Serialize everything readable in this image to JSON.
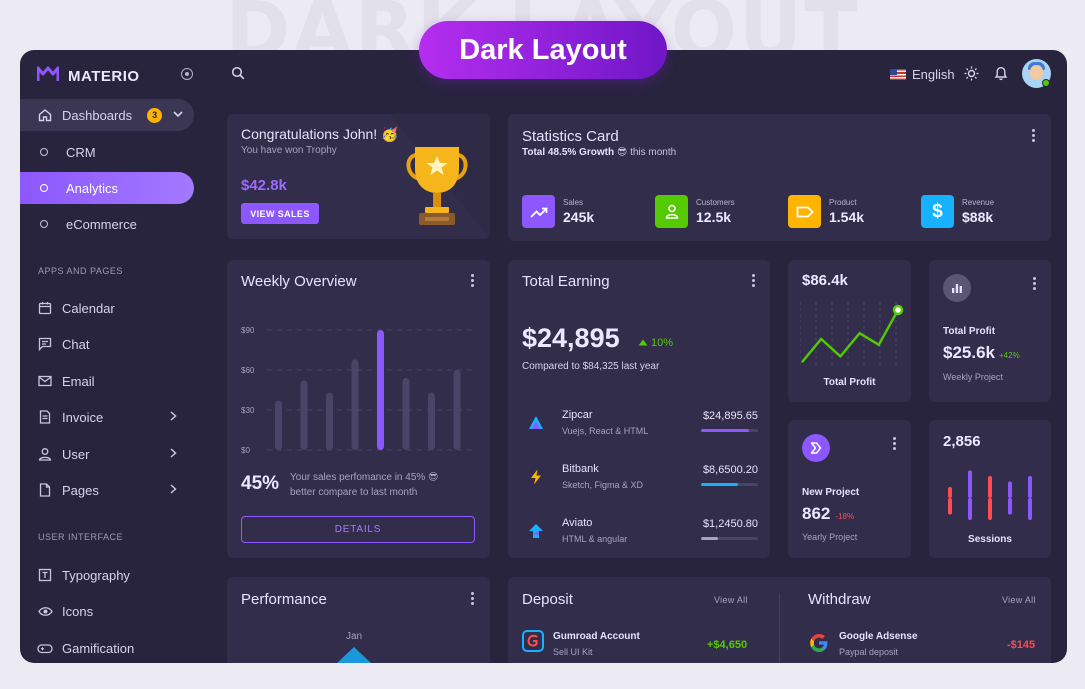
{
  "background_title": "DARK LAYOUT",
  "banner": {
    "label": "Dark Layout"
  },
  "brand": {
    "name": "MATERIO"
  },
  "sidebar": {
    "dashboards": {
      "label": "Dashboards",
      "badge": "3"
    },
    "sub_items": [
      {
        "label": "CRM"
      },
      {
        "label": "Analytics"
      },
      {
        "label": "eCommerce"
      }
    ],
    "section_apps": "APPS AND PAGES",
    "apps": [
      {
        "label": "Calendar"
      },
      {
        "label": "Chat"
      },
      {
        "label": "Email"
      },
      {
        "label": "Invoice"
      },
      {
        "label": "User"
      },
      {
        "label": "Pages"
      }
    ],
    "section_ui": "USER INTERFACE",
    "ui": [
      {
        "label": "Typography"
      },
      {
        "label": "Icons"
      },
      {
        "label": "Gamification"
      }
    ]
  },
  "topbar": {
    "language": "English"
  },
  "congrats": {
    "title": "Congratulations John! 🥳",
    "subtitle": "You have won Trophy",
    "amount": "$42.8k",
    "button": "VIEW SALES"
  },
  "statistics": {
    "title": "Statistics Card",
    "growth": "Total 48.5% Growth",
    "growth_emoji": "😎",
    "period": "this month",
    "items": [
      {
        "label": "Sales",
        "value": "245k",
        "color": "#8c57ff",
        "icon": "trending-up-icon"
      },
      {
        "label": "Customers",
        "value": "12.5k",
        "color": "#56ca00",
        "icon": "user-icon"
      },
      {
        "label": "Product",
        "value": "1.54k",
        "color": "#ffb400",
        "icon": "label-icon"
      },
      {
        "label": "Revenue",
        "value": "$88k",
        "color": "#16b1ff",
        "icon": "dollar-icon"
      }
    ]
  },
  "weekly": {
    "title": "Weekly Overview",
    "y_ticks": [
      "$90",
      "$60",
      "$30",
      "$0"
    ],
    "percent": "45%",
    "text_line1": "Your sales perfomance in 45% 😎",
    "text_line2": "better compare to last month",
    "button": "DETAILS"
  },
  "earning": {
    "title": "Total Earning",
    "amount": "$24,895",
    "change": "10%",
    "compare": "Compared to $84,325 last year",
    "rows": [
      {
        "name": "Zipcar",
        "sub": "Vuejs, React & HTML",
        "amount": "$24,895.65",
        "progress": 0.85,
        "color": "#8c57ff"
      },
      {
        "name": "Bitbank",
        "sub": "Sketch, Figma & XD",
        "amount": "$8,6500.20",
        "progress": 0.65,
        "color": "#16b1ff"
      },
      {
        "name": "Aviato",
        "sub": "HTML & angular",
        "amount": "$1,2450.80",
        "progress": 0.3,
        "color": "#a8a3bf"
      }
    ]
  },
  "profit_chart": {
    "value": "$86.4k",
    "label": "Total Profit"
  },
  "total_profit": {
    "label": "Total Profit",
    "value": "$25.6k",
    "change": "+42%",
    "sub": "Weekly Project"
  },
  "new_project": {
    "label": "New Project",
    "value": "862",
    "change": "-18%",
    "sub": "Yearly Project"
  },
  "sessions": {
    "value": "2,856",
    "label": "Sessions"
  },
  "performance": {
    "title": "Performance",
    "month": "Jan"
  },
  "deposit": {
    "title": "Deposit",
    "view_all": "View All",
    "item": {
      "name": "Gumroad Account",
      "sub": "Sell UI Kit",
      "amount": "+$4,650"
    }
  },
  "withdraw": {
    "title": "Withdraw",
    "view_all": "View All",
    "item": {
      "name": "Google Adsense",
      "sub": "Paypal deposit",
      "amount": "-$145"
    }
  },
  "colors": {
    "primary": "#8c57ff",
    "success": "#56ca00",
    "error": "#ff4c51",
    "warning": "#ffb400",
    "info": "#16b1ff",
    "card": "#312d4b",
    "background": "#28243d"
  },
  "chart_data": [
    {
      "type": "bar",
      "title": "Weekly Overview",
      "categories": [],
      "values": [
        37,
        52,
        43,
        68,
        90,
        54,
        43,
        60
      ],
      "ylim": [
        0,
        90
      ],
      "y_ticks": [
        "$90",
        "$60",
        "$30",
        "$0"
      ]
    },
    {
      "type": "line",
      "title": "",
      "values": [
        5,
        25,
        10,
        30,
        20,
        50
      ]
    },
    {
      "type": "bar",
      "title": "",
      "series": [
        {
          "values": [
            2,
            5,
            4,
            3,
            4
          ]
        },
        {
          "values": [
            -3,
            -4,
            -4,
            -3,
            -4
          ]
        }
      ]
    }
  ]
}
